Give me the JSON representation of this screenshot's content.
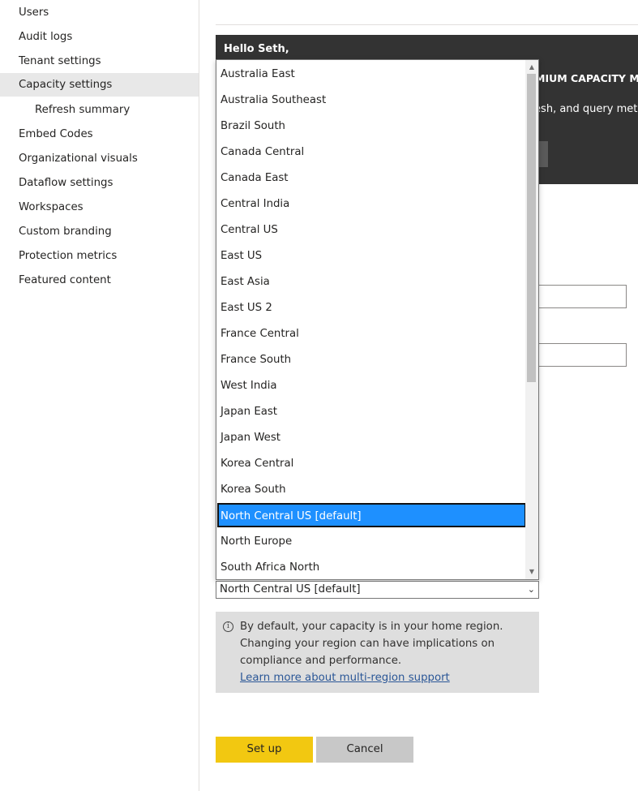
{
  "sidebar": {
    "items": [
      {
        "label": "Users"
      },
      {
        "label": "Audit logs"
      },
      {
        "label": "Tenant settings"
      },
      {
        "label": "Capacity settings",
        "active": true
      },
      {
        "label": "Refresh summary",
        "sub": true
      },
      {
        "label": "Embed Codes"
      },
      {
        "label": "Organizational visuals"
      },
      {
        "label": "Dataflow settings"
      },
      {
        "label": "Workspaces"
      },
      {
        "label": "Custom branding"
      },
      {
        "label": "Protection metrics"
      },
      {
        "label": "Featured content"
      }
    ]
  },
  "banner": {
    "greeting": "Hello Seth,",
    "heading_partial": "MIUM CAPACITY ME",
    "desc_partial": "resh, and query metr"
  },
  "region_dropdown": {
    "options": [
      "Australia East",
      "Australia Southeast",
      "Brazil South",
      "Canada Central",
      "Canada East",
      "Central India",
      "Central US",
      "East US",
      "East Asia",
      "East US 2",
      "France Central",
      "France South",
      "West India",
      "Japan East",
      "Japan West",
      "Korea Central",
      "Korea South",
      "North Central US [default]",
      "North Europe",
      "South Africa North"
    ],
    "selected_index": 17,
    "selected_value": "North Central US [default]"
  },
  "info": {
    "icon": "info-icon",
    "line1": "By default, your capacity is in your home region.",
    "line2": "Changing your region can have implications on",
    "line3": "compliance and performance.",
    "link": "Learn more about multi-region support"
  },
  "actions": {
    "setup_label": "Set up",
    "cancel_label": "Cancel"
  },
  "colors": {
    "accent_yellow": "#f2c811",
    "selection_blue": "#1e90ff",
    "banner_bg": "#333333"
  }
}
